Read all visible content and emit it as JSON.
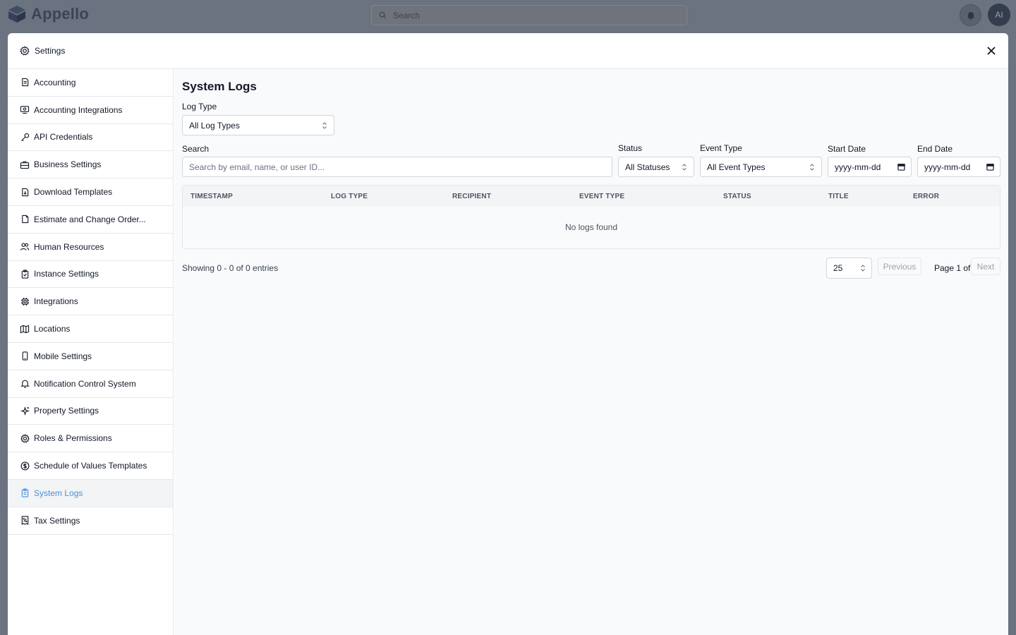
{
  "app": {
    "name": "Appello",
    "search_placeholder": "Search",
    "avatar_initials": "AI"
  },
  "modal": {
    "title": "Settings"
  },
  "sidebar": {
    "items": [
      {
        "label": "Accounting",
        "icon": "receipt-icon"
      },
      {
        "label": "Accounting Integrations",
        "icon": "monitor-dollar-icon"
      },
      {
        "label": "API Credentials",
        "icon": "key-icon"
      },
      {
        "label": "Business Settings",
        "icon": "briefcase-icon"
      },
      {
        "label": "Download Templates",
        "icon": "file-download-icon"
      },
      {
        "label": "Estimate and Change Order...",
        "icon": "file-icon"
      },
      {
        "label": "Human Resources",
        "icon": "users-icon"
      },
      {
        "label": "Instance Settings",
        "icon": "clipboard-check-icon"
      },
      {
        "label": "Integrations",
        "icon": "cpu-icon"
      },
      {
        "label": "Locations",
        "icon": "map-icon"
      },
      {
        "label": "Mobile Settings",
        "icon": "smartphone-icon"
      },
      {
        "label": "Notification Control System",
        "icon": "bell-icon"
      },
      {
        "label": "Property Settings",
        "icon": "sparkles-icon"
      },
      {
        "label": "Roles & Permissions",
        "icon": "gear-icon"
      },
      {
        "label": "Schedule of Values Templates",
        "icon": "dollar-circle-icon"
      },
      {
        "label": "System Logs",
        "icon": "clipboard-list-icon",
        "active": true
      },
      {
        "label": "Tax Settings",
        "icon": "receipt-percent-icon"
      }
    ]
  },
  "page": {
    "title": "System Logs",
    "filters": {
      "log_type_label": "Log Type",
      "log_type_value": "All Log Types",
      "search_label": "Search",
      "search_placeholder": "Search by email, name, or user ID...",
      "status_label": "Status",
      "status_value": "All Statuses",
      "event_type_label": "Event Type",
      "event_type_value": "All Event Types",
      "start_date_label": "Start Date",
      "start_date_value": "yyyy-mm-dd",
      "end_date_label": "End Date",
      "end_date_value": "yyyy-mm-dd"
    },
    "table": {
      "columns": [
        "TIMESTAMP",
        "LOG TYPE",
        "RECIPIENT",
        "EVENT TYPE",
        "STATUS",
        "TITLE",
        "ERROR"
      ],
      "empty_text": "No logs found"
    },
    "pagination": {
      "showing": "Showing 0 - 0 of 0 entries",
      "page_size": "25",
      "previous": "Previous",
      "page_text": "Page 1 of 1",
      "next": "Next"
    }
  },
  "colors": {
    "accent": "#4a90d9",
    "overlay": "#6b7280",
    "border": "#e5e7eb"
  }
}
